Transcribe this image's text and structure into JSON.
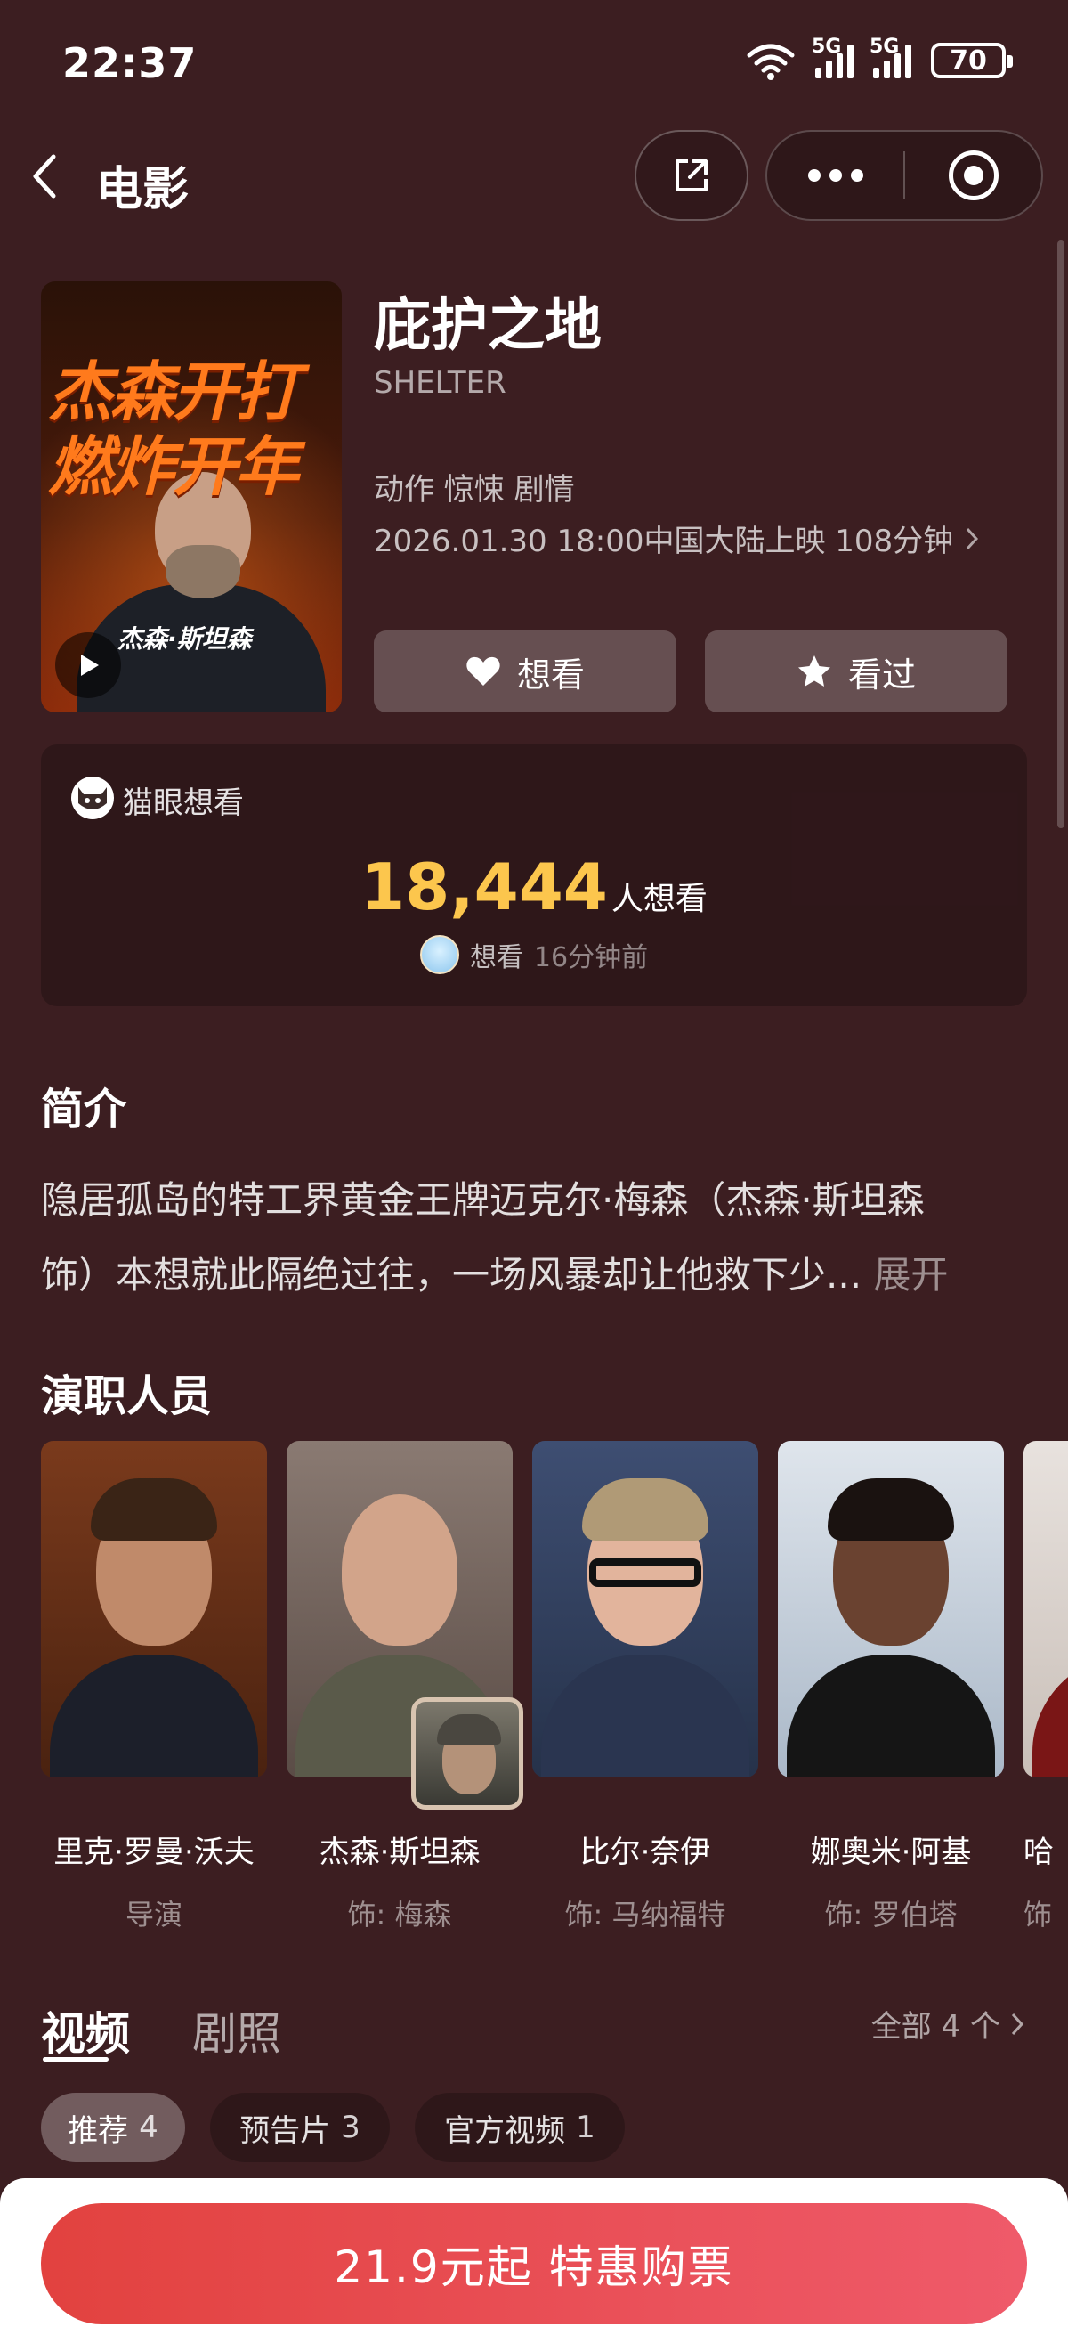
{
  "status_bar": {
    "time": "22:37",
    "network_1": "5G",
    "network_2": "5G",
    "battery": "70"
  },
  "nav": {
    "title": "电影"
  },
  "movie": {
    "poster_tagline": "杰森开打 燃炸开年",
    "poster_name": "杰森·斯坦森",
    "title": "庇护之地",
    "title_en": "SHELTER",
    "genres": "动作 惊悚 剧情",
    "release": "2026.01.30 18:00中国大陆上映 108分钟",
    "want_button": "想看",
    "seen_button": "看过"
  },
  "want_card": {
    "label": "猫眼想看",
    "count": "18,444",
    "unit": "人想看",
    "recent_action": "想看",
    "recent_time": "16分钟前"
  },
  "synopsis": {
    "title": "简介",
    "line1": "隐居孤岛的特工界黄金王牌迈克尔·梅森（杰森·斯坦森",
    "line2": "饰）本想就此隔绝过往，一场风暴却让他救下少...",
    "expand": "展开"
  },
  "cast": {
    "title": "演职人员",
    "members": [
      {
        "name": "里克·罗曼·沃夫",
        "role": "导演"
      },
      {
        "name": "杰森·斯坦森",
        "role": "饰: 梅森"
      },
      {
        "name": "比尔·奈伊",
        "role": "饰: 马纳福特"
      },
      {
        "name": "娜奥米·阿基",
        "role": "饰: 罗伯塔"
      },
      {
        "name": "哈",
        "role": "饰"
      }
    ]
  },
  "media": {
    "tabs": [
      "视频",
      "剧照"
    ],
    "see_all": "全部 4 个",
    "chips": [
      {
        "label": "推荐",
        "count": "4"
      },
      {
        "label": "预告片",
        "count": "3"
      },
      {
        "label": "官方视频",
        "count": "1"
      }
    ]
  },
  "buy": {
    "label": "21.9元起 特惠购票"
  },
  "colors": {
    "background": "#3c1e21",
    "accent_yellow": "#fcc64d",
    "buy_red": "#e2423f"
  }
}
